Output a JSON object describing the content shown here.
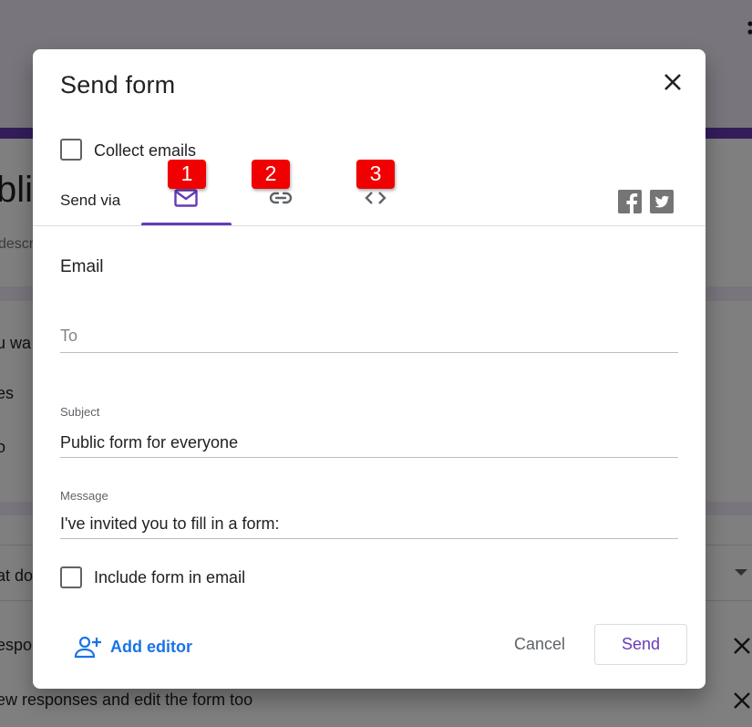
{
  "background": {
    "title_fragment": "blic",
    "description_fragment": "descr",
    "question_fragments": [
      "u wa",
      "es",
      "o"
    ],
    "dropdown_fragment": "at do",
    "response_rows": [
      "espon",
      "ew responses and edit the form too"
    ]
  },
  "dialog": {
    "title": "Send form",
    "collect_emails_label": "Collect emails",
    "send_via_label": "Send via",
    "tabs": [
      {
        "id": "email",
        "icon": "mail-icon",
        "badge": "1",
        "active": true
      },
      {
        "id": "link",
        "icon": "link-icon",
        "badge": "2",
        "active": false
      },
      {
        "id": "embed",
        "icon": "code-icon",
        "badge": "3",
        "active": false
      }
    ],
    "social": [
      "facebook-icon",
      "twitter-icon"
    ],
    "section_title": "Email",
    "to_placeholder": "To",
    "subject_label": "Subject",
    "subject_value": "Public form for everyone",
    "message_label": "Message",
    "message_value": "I've invited you to fill in a form:",
    "include_form_label": "Include form in email",
    "add_editor_label": "Add editor",
    "cancel_label": "Cancel",
    "send_label": "Send"
  },
  "colors": {
    "accent": "#673ab7",
    "link_blue": "#1a73e8",
    "badge_red": "#f00000"
  }
}
